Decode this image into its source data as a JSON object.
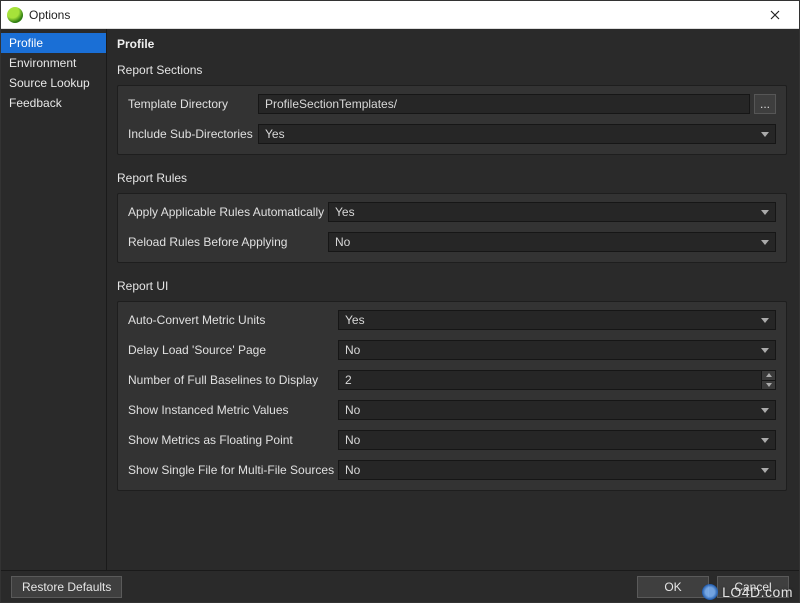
{
  "window": {
    "title": "Options"
  },
  "sidebar": {
    "items": [
      {
        "label": "Profile",
        "selected": true
      },
      {
        "label": "Environment",
        "selected": false
      },
      {
        "label": "Source Lookup",
        "selected": false
      },
      {
        "label": "Feedback",
        "selected": false
      }
    ]
  },
  "panel": {
    "title": "Profile",
    "groups": {
      "report_sections": {
        "header": "Report Sections",
        "template_directory": {
          "label": "Template Directory",
          "value": "ProfileSectionTemplates/",
          "browse": "..."
        },
        "include_subdirs": {
          "label": "Include Sub-Directories",
          "value": "Yes"
        }
      },
      "report_rules": {
        "header": "Report Rules",
        "apply_auto": {
          "label": "Apply Applicable Rules Automatically",
          "value": "Yes"
        },
        "reload_before": {
          "label": "Reload Rules Before Applying",
          "value": "No"
        }
      },
      "report_ui": {
        "header": "Report UI",
        "auto_convert": {
          "label": "Auto-Convert Metric Units",
          "value": "Yes"
        },
        "delay_load": {
          "label": "Delay Load 'Source' Page",
          "value": "No"
        },
        "num_baselines": {
          "label": "Number of Full Baselines to Display",
          "value": "2"
        },
        "show_instanced": {
          "label": "Show Instanced Metric Values",
          "value": "No"
        },
        "show_float": {
          "label": "Show Metrics as Floating Point",
          "value": "No"
        },
        "show_single": {
          "label": "Show Single File for Multi-File Sources",
          "value": "No"
        }
      }
    }
  },
  "footer": {
    "restore": "Restore Defaults",
    "ok": "OK",
    "cancel": "Cancel"
  },
  "watermark": {
    "text": "LO4D.com"
  }
}
